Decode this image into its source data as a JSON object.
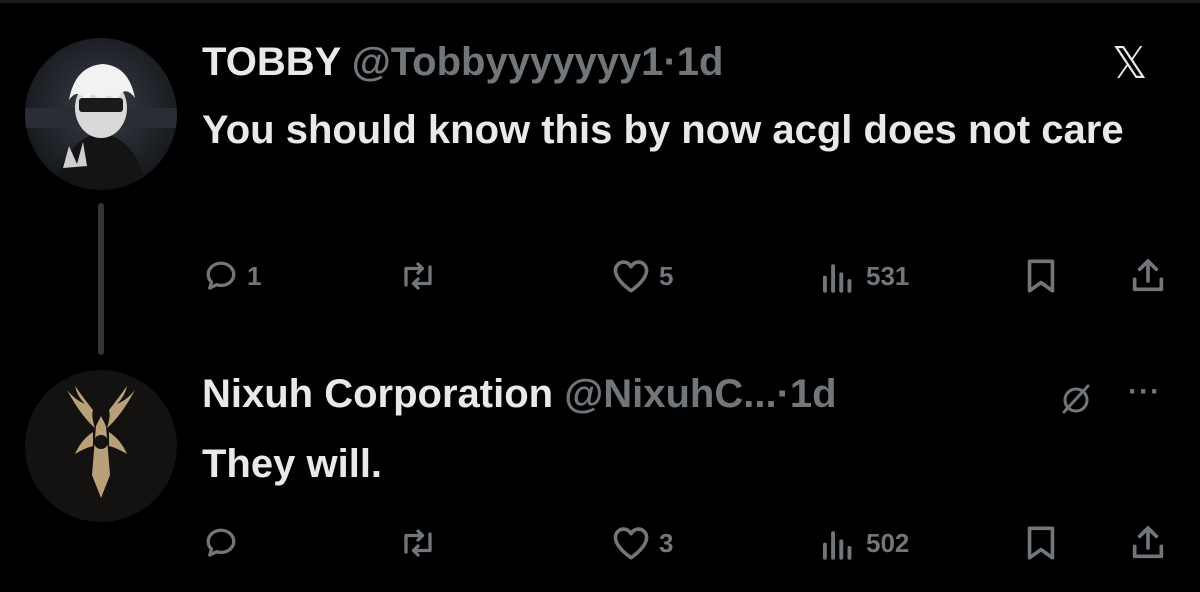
{
  "colors": {
    "background": "#000000",
    "text": "#e7e9ea",
    "muted": "#71767b",
    "thread_line": "#333639"
  },
  "app_icon": "x-logo-icon",
  "posts": [
    {
      "display_name": "TOBBY",
      "handle": "@Tobbyyyyyyy1",
      "time": "1d",
      "text": "You should know this by now acgl does not care",
      "header_icon": "x-logo-icon",
      "reply_count": "1",
      "repost_count": "",
      "like_count": "5",
      "view_count": "531"
    },
    {
      "display_name": "Nixuh Corporation",
      "handle": "@NixuhC...",
      "time": "1d",
      "text": "They will.",
      "header_icon": "mute-icon",
      "more_icon": "more-icon",
      "reply_count": "",
      "repost_count": "",
      "like_count": "3",
      "view_count": "502"
    }
  ],
  "separator": "·"
}
